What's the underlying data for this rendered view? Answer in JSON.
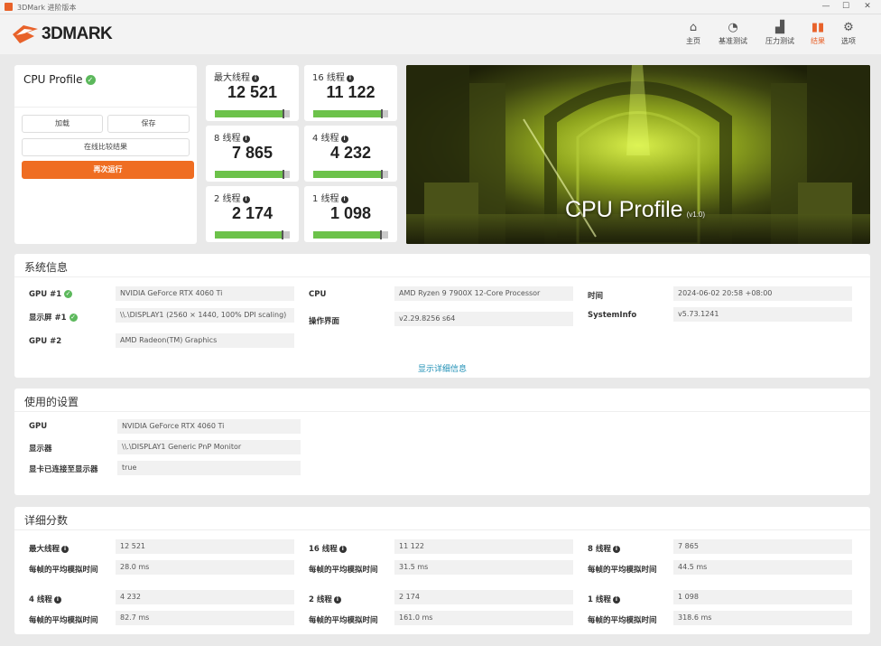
{
  "window": {
    "title": "3DMark 进阶版本"
  },
  "app": {
    "logo": "3DMARK"
  },
  "nav": [
    {
      "label": "主页",
      "icon": "home-icon"
    },
    {
      "label": "基准测试",
      "icon": "gauge-icon"
    },
    {
      "label": "压力测试",
      "icon": "stress-chart-icon"
    },
    {
      "label": "结果",
      "icon": "results-bar-icon",
      "active": true
    },
    {
      "label": "选项",
      "icon": "gear-icon"
    }
  ],
  "profile": {
    "name": "CPU Profile",
    "load": "加载",
    "save": "保存",
    "compare": "在线比较结果",
    "run_again": "再次运行"
  },
  "scores": [
    {
      "label": "最大线程",
      "value": "12 521",
      "fill_pct": 92
    },
    {
      "label": "16 线程",
      "value": "11 122",
      "fill_pct": 92
    },
    {
      "label": "8 线程",
      "value": "7 865",
      "fill_pct": 91
    },
    {
      "label": "4 线程",
      "value": "4 232",
      "fill_pct": 92
    },
    {
      "label": "2 线程",
      "value": "2 174",
      "fill_pct": 90
    },
    {
      "label": "1 线程",
      "value": "1 098",
      "fill_pct": 90
    }
  ],
  "hero": {
    "title": "CPU Profile",
    "version": "(v1.0)"
  },
  "sysinfo": {
    "title": "系统信息",
    "gpu1_label": "GPU #1",
    "gpu1": "NVIDIA GeForce RTX 4060 Ti",
    "display1_label": "显示屏 #1",
    "display1": "\\\\.\\DISPLAY1 (2560 × 1440, 100% DPI scaling)",
    "gpu2_label": "GPU #2",
    "gpu2": "AMD Radeon(TM) Graphics",
    "cpu_label": "CPU",
    "cpu": "AMD Ryzen 9 7900X 12-Core Processor",
    "os_label": "操作界面",
    "os": "v2.29.8256 s64",
    "time_label": "时间",
    "time": "2024-06-02 20:58 +08:00",
    "si_label": "SystemInfo",
    "si": "v5.73.1241",
    "more": "显示详细信息"
  },
  "settings": {
    "title": "使用的设置",
    "gpu_label": "GPU",
    "gpu": "NVIDIA GeForce RTX 4060 Ti",
    "display_label": "显示器",
    "display": "\\\\.\\DISPLAY1 Generic PnP Monitor",
    "connected_label": "显卡已连接至显示器",
    "connected": "true"
  },
  "detail": {
    "title": "详细分数",
    "frame_label": "每帧的平均模拟时间",
    "items": [
      {
        "label": "最大线程",
        "score": "12 521",
        "time": "28.0 ms"
      },
      {
        "label": "16 线程",
        "score": "11 122",
        "time": "31.5 ms"
      },
      {
        "label": "8 线程",
        "score": "7 865",
        "time": "44.5 ms"
      },
      {
        "label": "4 线程",
        "score": "4 232",
        "time": "82.7 ms"
      },
      {
        "label": "2 线程",
        "score": "2 174",
        "time": "161.0 ms"
      },
      {
        "label": "1 线程",
        "score": "1 098",
        "time": "318.6 ms"
      }
    ]
  },
  "colors": {
    "accent": "#ef6d22",
    "bar_fill": "#6cc24a",
    "check": "#5cb85c",
    "link": "#1e8fb5"
  }
}
